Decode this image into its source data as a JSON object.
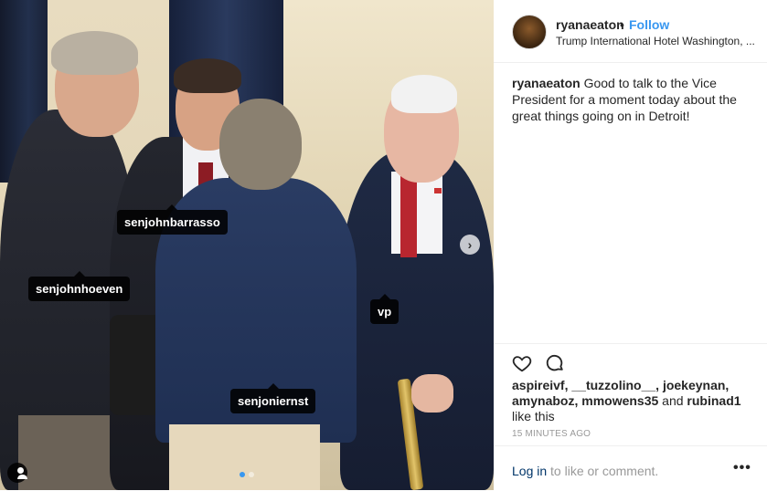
{
  "post": {
    "username": "ryanaeaton",
    "separator": "•",
    "follow_label": "Follow",
    "location": "Trump International Hotel Washington, ...",
    "caption_username": "ryanaeaton",
    "caption_text": "Good to talk to the Vice President for a moment today about the great things going on in Detroit!",
    "likes_users": "aspireivf, __tuzzolino__, joekeynan, amynaboz, mmowens35",
    "likes_and": "and",
    "likes_last": "rubinad1",
    "likes_suffix": "like this",
    "timestamp": "15 MINUTES AGO",
    "login_link": "Log in",
    "login_suffix": "to like or comment.",
    "more_label": "•••"
  },
  "photo": {
    "tags": [
      "senjohnbarrasso",
      "senjohnhoeven",
      "vp",
      "senjoniernst"
    ],
    "next_label": "›",
    "carousel_total": 2,
    "carousel_active": 1
  },
  "colors": {
    "accent": "#3897f0",
    "link": "#003569",
    "muted": "#999999"
  },
  "icons": {
    "like": "heart-icon",
    "comment": "comment-bubble-icon",
    "next": "chevron-right-icon",
    "user_tags": "person-icon"
  }
}
